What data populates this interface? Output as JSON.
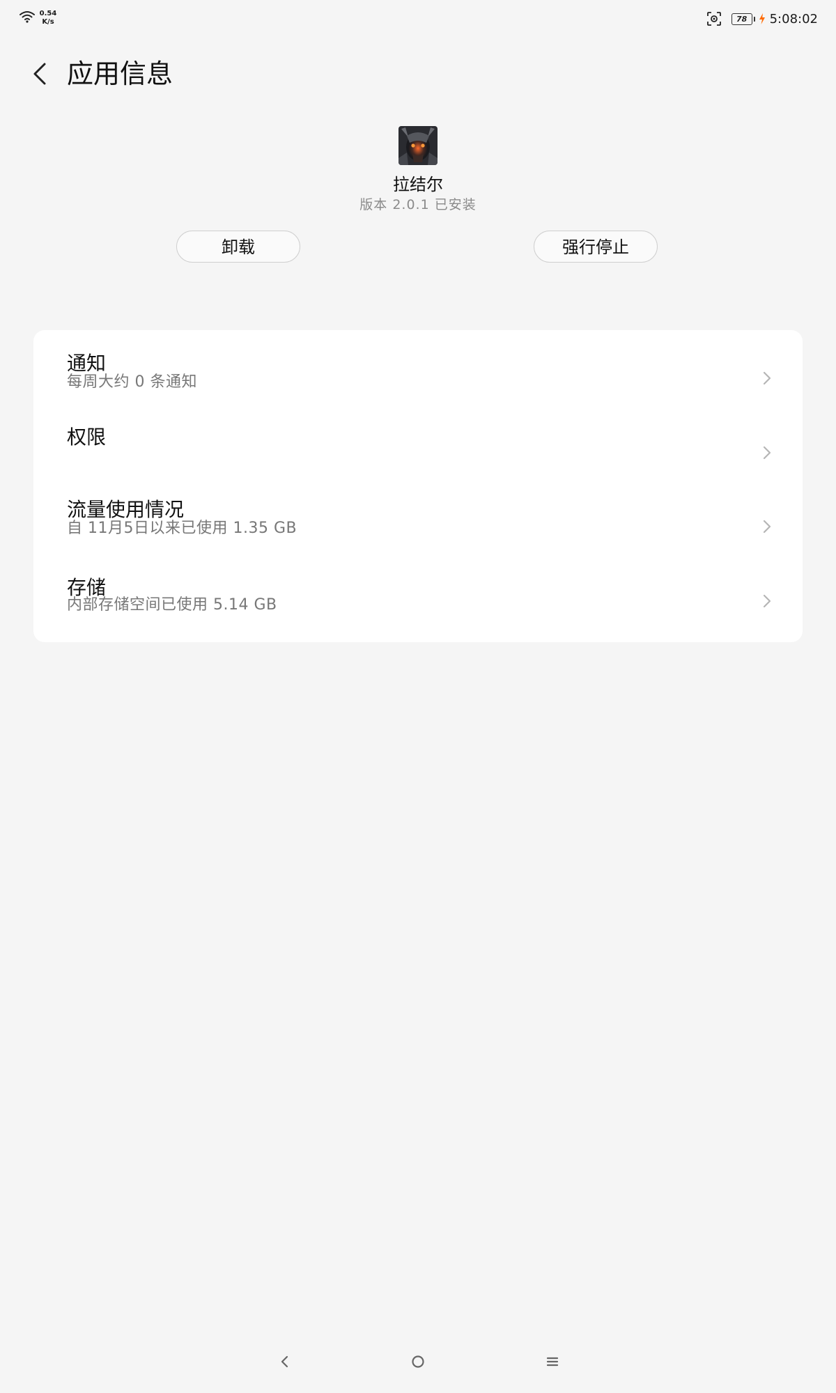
{
  "status_bar": {
    "net_speed_value": "0.54",
    "net_speed_unit": "K/s",
    "battery_level": "78",
    "time": "5:08:02"
  },
  "header": {
    "title": "应用信息"
  },
  "app": {
    "name": "拉结尔",
    "version": "版本 2.0.1 已安装"
  },
  "actions": {
    "uninstall_label": "卸载",
    "force_stop_label": "强行停止"
  },
  "settings": {
    "items": [
      {
        "title": "通知",
        "subtitle": "每周大约 0 条通知"
      },
      {
        "title": "权限",
        "subtitle": ""
      },
      {
        "title": "流量使用情况",
        "subtitle": "自 11月5日以来已使用 1.35 GB"
      },
      {
        "title": "存储",
        "subtitle": "内部存储空间已使用 5.14 GB"
      }
    ]
  },
  "colors": {
    "background": "#f5f5f5",
    "card": "#ffffff",
    "charging_bolt": "#ff6a00"
  }
}
